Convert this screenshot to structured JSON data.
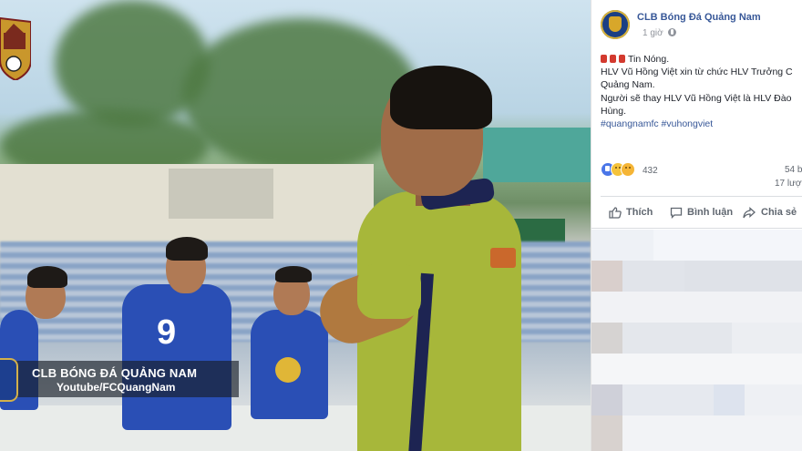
{
  "photo": {
    "caption_title": "CLB BÓNG ĐÁ QUẢNG NAM",
    "caption_subtitle": "Youtube/FCQuangNam",
    "player_number": "9"
  },
  "post": {
    "page_name": "CLB Bóng Đá Quảng Nam",
    "time": "1 giờ",
    "text_lines": [
      "Tin Nóng.",
      "HLV Vũ Hồng Việt xin từ chức HLV Trưởng C",
      "Quảng Nam.",
      "Người sẽ thay HLV Vũ Hồng Việt là HLV Đào",
      "Hùng."
    ],
    "hashtags": "#quangnamfc #vuhongviet",
    "reaction_count": "432",
    "comments": "54 b",
    "shares": "17 lượt",
    "actions": {
      "like": "Thích",
      "comment": "Bình luận",
      "share": "Chia sẻ"
    }
  }
}
